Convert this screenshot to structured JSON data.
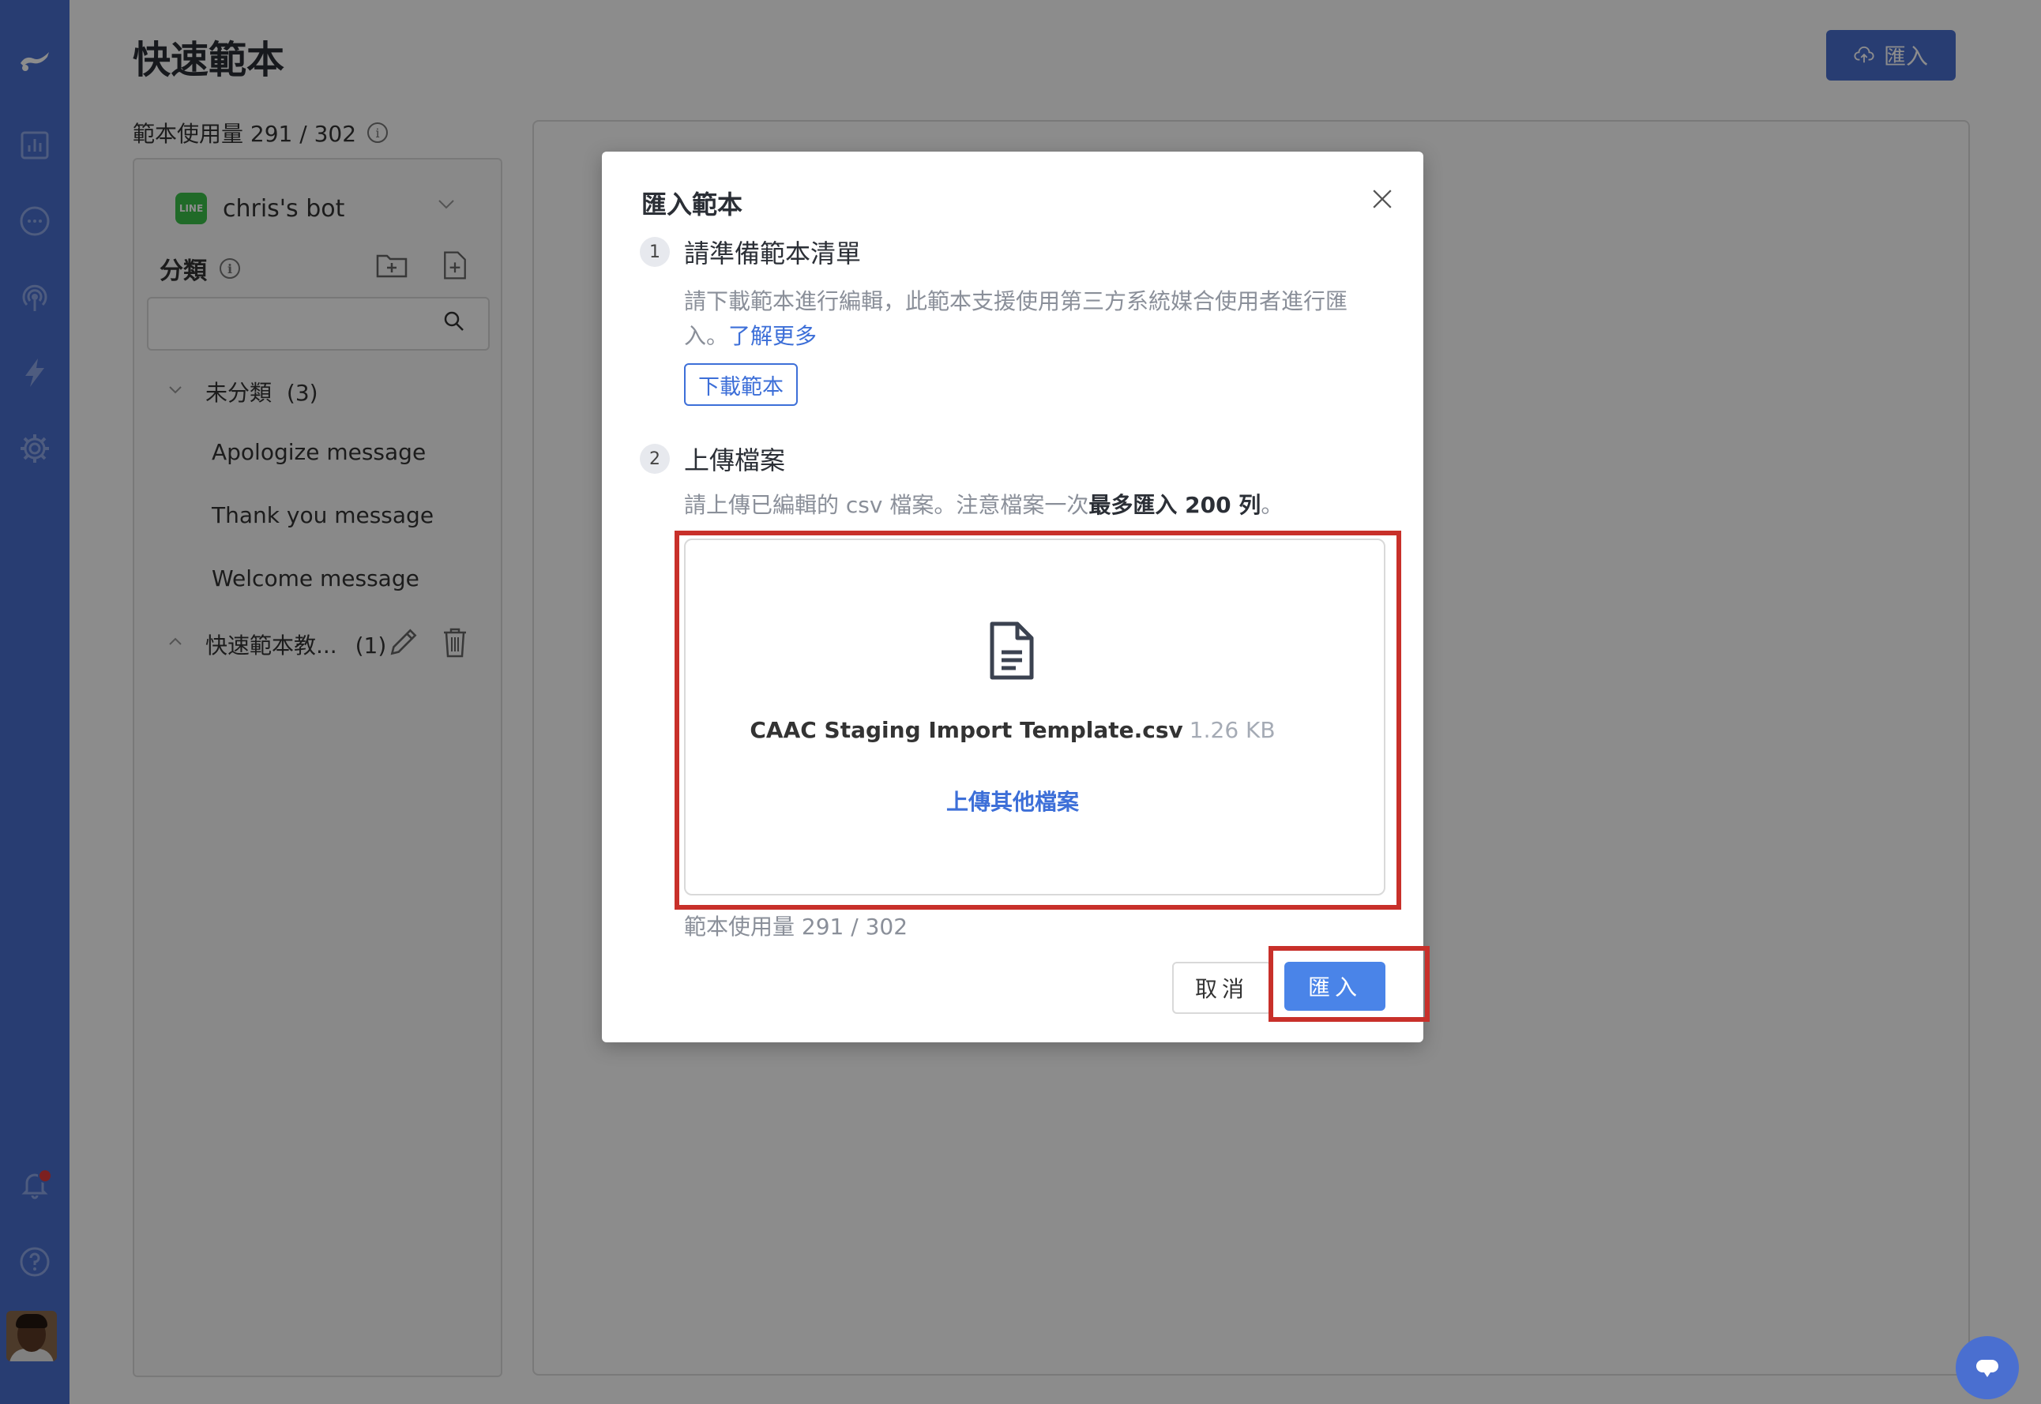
{
  "page": {
    "title": "快速範本",
    "import_button": "匯入",
    "usage_label": "範本使用量 291 / 302"
  },
  "sidebar_left": {
    "bot_name": "chris's bot",
    "line_badge": "LINE",
    "category_title": "分類",
    "search_placeholder": "",
    "uncategorized": {
      "label": "未分類",
      "count": "(3)"
    },
    "templates": [
      "Apologize message",
      "Thank you message",
      "Welcome message"
    ],
    "folder": {
      "label": "快速範本教...",
      "count": "(1)"
    }
  },
  "modal": {
    "title": "匯入範本",
    "step1": {
      "number": "1",
      "title": "請準備範本清單",
      "description": "請下載範本進行編輯，此範本支援使用第三方系統媒合使用者進行匯入。",
      "learn_more": "了解更多",
      "download_button": "下載範本"
    },
    "step2": {
      "number": "2",
      "title": "上傳檔案",
      "description_prefix": "請上傳已編輯的 csv 檔案。注意檔案一次",
      "description_bold": "最多匯入 200 列",
      "description_suffix": "。"
    },
    "file": {
      "name": "CAAC Staging Import Template.csv",
      "size": "1.26 KB",
      "upload_other": "上傳其他檔案"
    },
    "usage": "範本使用量 291 / 302",
    "cancel_button": "取消",
    "confirm_button": "匯入"
  },
  "colors": {
    "sidebar": "#4a6fd0",
    "primary": "#4a84e8",
    "link": "#3d6fd8",
    "highlight": "#c8302a",
    "line_green": "#3bc14a"
  },
  "icons": {
    "sidebar": [
      "logo-icon",
      "chart-icon",
      "chat-icon",
      "broadcast-icon",
      "lightning-icon",
      "gear-icon",
      "bell-icon",
      "help-icon"
    ]
  }
}
